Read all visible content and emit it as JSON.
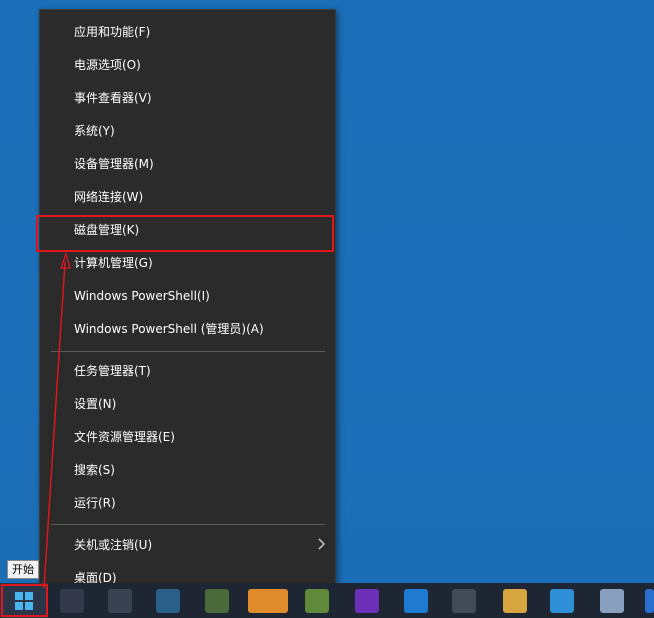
{
  "context_menu": {
    "group1": [
      {
        "label": "应用和功能(F)"
      },
      {
        "label": "电源选项(O)"
      },
      {
        "label": "事件查看器(V)"
      },
      {
        "label": "系统(Y)"
      },
      {
        "label": "设备管理器(M)"
      },
      {
        "label": "网络连接(W)"
      },
      {
        "label": "磁盘管理(K)",
        "highlighted": true
      },
      {
        "label": "计算机管理(G)"
      },
      {
        "label": "Windows PowerShell(I)"
      },
      {
        "label": "Windows PowerShell (管理员)(A)"
      }
    ],
    "group2": [
      {
        "label": "任务管理器(T)"
      },
      {
        "label": "设置(N)"
      },
      {
        "label": "文件资源管理器(E)"
      },
      {
        "label": "搜索(S)"
      },
      {
        "label": "运行(R)"
      }
    ],
    "group3": [
      {
        "label": "关机或注销(U)",
        "has_submenu": true,
        "icon": "chevron-right-icon"
      },
      {
        "label": "桌面(D)"
      }
    ]
  },
  "start_tooltip": "开始",
  "taskbar": {
    "start_icon": "windows-logo-icon",
    "apps": [
      "app-icon",
      "app-icon",
      "app-icon",
      "app-icon",
      "app-icon",
      "app-icon",
      "visual-studio-icon",
      "vscode-icon",
      "app-icon",
      "app-icon",
      "app-icon",
      "app-icon",
      "app-icon"
    ]
  },
  "annotation_color": "#e0161f"
}
